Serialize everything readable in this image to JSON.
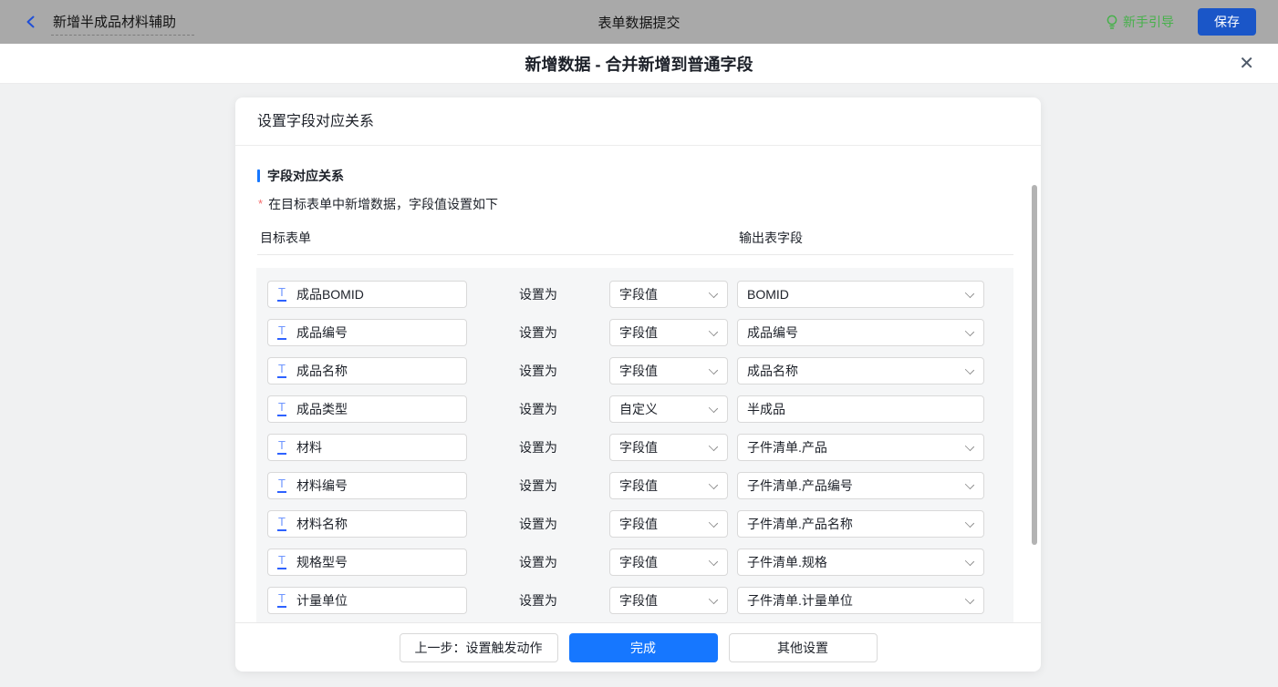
{
  "colors": {
    "topbar-bg": "#a9a9a9",
    "page-bg": "#f0f1f2",
    "accent": "#1677ff",
    "save-blue": "#1a56c8",
    "guide-green": "#47b14b",
    "required-red": "#f56c6c",
    "field-icon-blue": "#2e62ff"
  },
  "topbar": {
    "back_title": "新增半成品材料辅助",
    "center_title": "表单数据提交",
    "guide_label": "新手引导",
    "save_label": "保存"
  },
  "modal": {
    "title": "新增数据 - 合并新增到普通字段",
    "close_icon": "✕"
  },
  "card": {
    "header": "设置字段对应关系",
    "section_title": "字段对应关系",
    "section_note": "在目标表单中新增数据，字段值设置如下",
    "required_mark": "*"
  },
  "table": {
    "col_left": "目标表单",
    "col_right": "输出表字段",
    "set_as_label": "设置为",
    "field_icon": "T",
    "rows": [
      {
        "field": "成品BOMID",
        "mode": "字段值",
        "value": "BOMID",
        "value_type": "select"
      },
      {
        "field": "成品编号",
        "mode": "字段值",
        "value": "成品编号",
        "value_type": "select"
      },
      {
        "field": "成品名称",
        "mode": "字段值",
        "value": "成品名称",
        "value_type": "select"
      },
      {
        "field": "成品类型",
        "mode": "自定义",
        "value": "半成品",
        "value_type": "input"
      },
      {
        "field": "材料",
        "mode": "字段值",
        "value": "子件清单.产品",
        "value_type": "select"
      },
      {
        "field": "材料编号",
        "mode": "字段值",
        "value": "子件清单.产品编号",
        "value_type": "select"
      },
      {
        "field": "材料名称",
        "mode": "字段值",
        "value": "子件清单.产品名称",
        "value_type": "select"
      },
      {
        "field": "规格型号",
        "mode": "字段值",
        "value": "子件清单.规格",
        "value_type": "select"
      },
      {
        "field": "计量单位",
        "mode": "字段值",
        "value": "子件清单.计量单位",
        "value_type": "select"
      }
    ],
    "partial_row_visible": true
  },
  "footer": {
    "prev_label": "上一步：设置触发动作",
    "done_label": "完成",
    "other_label": "其他设置"
  }
}
